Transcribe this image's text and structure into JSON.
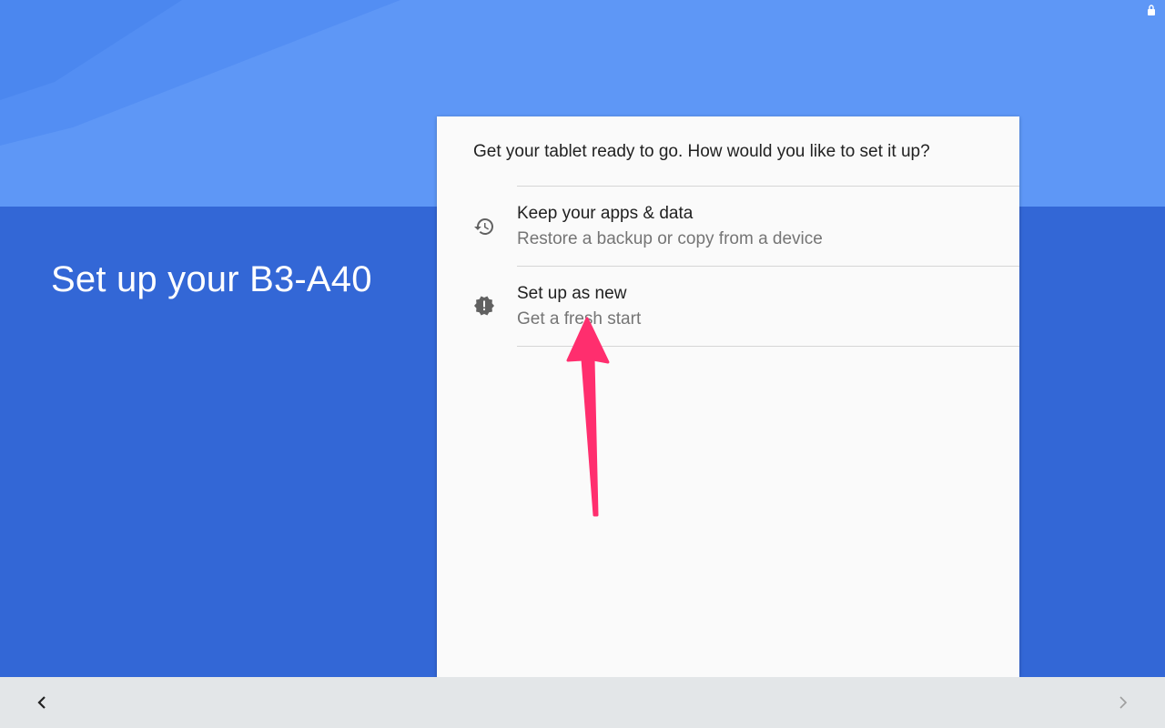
{
  "page": {
    "title": "Set up your B3-A40"
  },
  "card": {
    "question": "Get your tablet ready to go. How would you like to set it up?",
    "options": [
      {
        "title": "Keep your apps & data",
        "subtitle": "Restore a backup or copy from a device",
        "icon": "restore-history-icon"
      },
      {
        "title": "Set up as new",
        "subtitle": "Get a fresh start",
        "icon": "new-badge-icon"
      }
    ]
  },
  "navigation": {
    "back_icon": "chevron-left-icon",
    "next_icon": "chevron-right-icon"
  },
  "colors": {
    "header_light_blue": "#5e97f6",
    "main_blue": "#3367d6",
    "card_background": "#fafafa",
    "nav_bar": "#e3e6e8",
    "annotation_arrow": "#ff2e6e"
  }
}
